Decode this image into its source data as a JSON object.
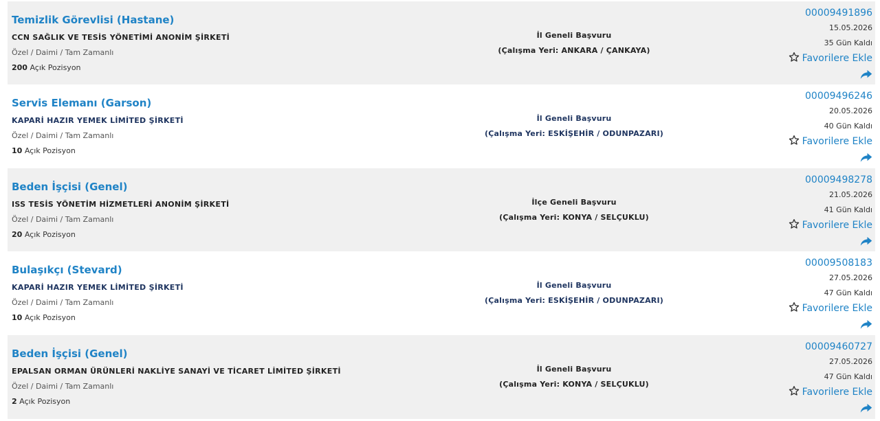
{
  "labels": {
    "positions_suffix": "Açık Pozisyon",
    "favorite": "Favorilere Ekle",
    "share_icon": "share-arrow-icon",
    "star_icon": "star-outline-icon"
  },
  "colors": {
    "link_blue": "#1f83c6",
    "row_gray": "#f0f0f0",
    "navy": "#1f3560"
  },
  "jobs": [
    {
      "title": "Temizlik Görevlisi (Hastane)",
      "company": "CCN SAĞLIK VE TESİS YÖNETİMİ ANONİM ŞİRKETİ",
      "type": "Özel / Daimi / Tam Zamanlı",
      "positions": "200",
      "scope": "İl Geneli Başvuru",
      "workplace": "(Çalışma Yeri: ANKARA / ÇANKAYA)",
      "ilan_no": "00009491896",
      "date": "15.05.2026",
      "remaining": "35 Gün Kaldı"
    },
    {
      "title": "Servis Elemanı (Garson)",
      "company": "KAPARİ HAZIR YEMEK LİMİTED ŞİRKETİ",
      "type": "Özel / Daimi / Tam Zamanlı",
      "positions": "10",
      "scope": "İl Geneli Başvuru",
      "workplace": "(Çalışma Yeri: ESKİŞEHİR / ODUNPAZARI)",
      "ilan_no": "00009496246",
      "date": "20.05.2026",
      "remaining": "40 Gün Kaldı"
    },
    {
      "title": "Beden İşçisi (Genel)",
      "company": "ISS TESİS YÖNETİM HİZMETLERİ ANONİM ŞİRKETİ",
      "type": "Özel / Daimi / Tam Zamanlı",
      "positions": "20",
      "scope": "İlçe Geneli Başvuru",
      "workplace": "(Çalışma Yeri: KONYA / SELÇUKLU)",
      "ilan_no": "00009498278",
      "date": "21.05.2026",
      "remaining": "41 Gün Kaldı"
    },
    {
      "title": "Bulaşıkçı (Stevard)",
      "company": "KAPARİ HAZIR YEMEK LİMİTED ŞİRKETİ",
      "type": "Özel / Daimi / Tam Zamanlı",
      "positions": "10",
      "scope": "İl Geneli Başvuru",
      "workplace": "(Çalışma Yeri: ESKİŞEHİR / ODUNPAZARI)",
      "ilan_no": "00009508183",
      "date": "27.05.2026",
      "remaining": "47 Gün Kaldı"
    },
    {
      "title": "Beden İşçisi (Genel)",
      "company": "EPALSAN ORMAN ÜRÜNLERİ NAKLİYE SANAYİ VE TİCARET LİMİTED ŞİRKETİ",
      "type": "Özel / Daimi / Tam Zamanlı",
      "positions": "2",
      "scope": "İl Geneli Başvuru",
      "workplace": "(Çalışma Yeri: KONYA / SELÇUKLU)",
      "ilan_no": "00009460727",
      "date": "27.05.2026",
      "remaining": "47 Gün Kaldı"
    }
  ]
}
